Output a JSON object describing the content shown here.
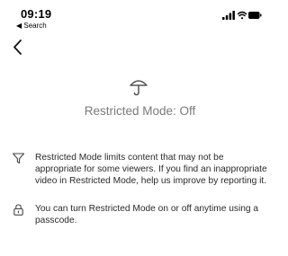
{
  "status_bar": {
    "time": "09:19",
    "back_app_label": "◀ Search",
    "icons": [
      "signal-icon",
      "wifi-icon",
      "battery-icon"
    ]
  },
  "nav": {
    "back_icon": "chevron-left-icon"
  },
  "hero": {
    "icon": "umbrella-icon",
    "title": "Restricted Mode: Off"
  },
  "info": [
    {
      "icon": "filter-icon",
      "text": "Restricted Mode limits content that may not be appropriate for some viewers. If you find an inappropriate video in Restricted Mode, help us improve by reporting it."
    },
    {
      "icon": "lock-icon",
      "text": "You can turn Restricted Mode on or off anytime using a passcode."
    }
  ],
  "colors": {
    "title_gray": "#7a7a7a",
    "text": "#2a2a2a",
    "icon_stroke": "#444444"
  }
}
